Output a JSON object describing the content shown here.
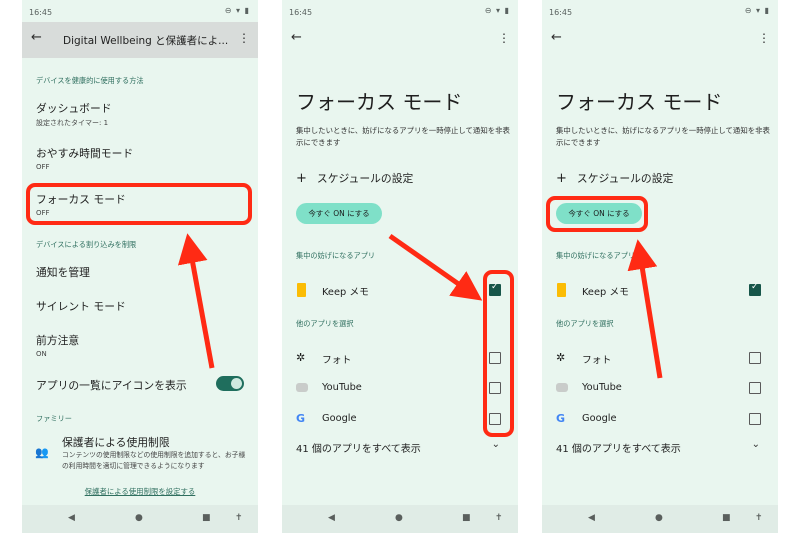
{
  "status": {
    "time": "16:45",
    "icons": "⊖ ▾ ▮"
  },
  "screen1": {
    "title": "Digital Wellbeing と保護者によ...",
    "section_health": "デバイスを健康的に使用する方法",
    "dashboard": {
      "title": "ダッシュボード",
      "sub": "設定されたタイマー: 1"
    },
    "bedtime": {
      "title": "おやすみ時間モード",
      "sub": "OFF"
    },
    "focus": {
      "title": "フォーカス モード",
      "sub": "OFF"
    },
    "section_interrupt": "デバイスによる割り込みを制限",
    "notify": "通知を管理",
    "silent": "サイレント モード",
    "heads_up": {
      "title": "前方注意",
      "sub": "ON"
    },
    "app_icon": "アプリの一覧にアイコンを表示",
    "section_family": "ファミリー",
    "parental": {
      "title": "保護者による使用制限",
      "desc": "コンテンツの使用制限などの使用制限を追加すると、お子様の利用時間を適切に管理できるようになります"
    },
    "link": "保護者による使用制限を設定する"
  },
  "focus_screen": {
    "title": "フォーカス モード",
    "desc": "集中したいときに、妨げになるアプリを一時停止して通知を非表示にできます",
    "schedule": "スケジュールの設定",
    "on_now": "今すぐ ON にする",
    "section_distract": "集中の妨げになるアプリ",
    "keep": "Keep メモ",
    "section_other": "他のアプリを選択",
    "apps": [
      "フォト",
      "YouTube",
      "Google"
    ],
    "show_all": "41 個のアプリをすべて表示"
  },
  "nav": {
    "back": "◀",
    "home": "●",
    "recents": "■",
    "access": "✝"
  },
  "colors": {
    "highlight": "#ff2a14",
    "accent": "#2f6f5f",
    "pill": "#7fe0c8"
  }
}
